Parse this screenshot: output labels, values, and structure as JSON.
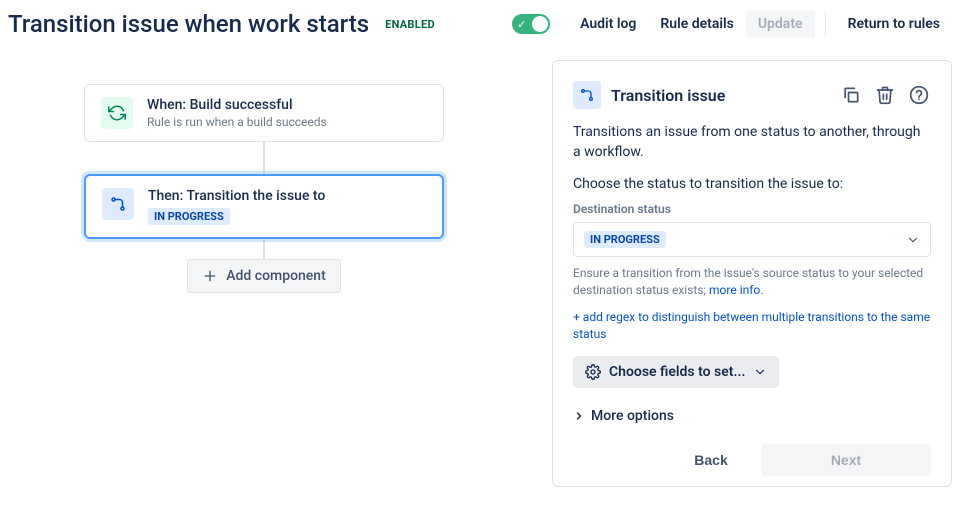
{
  "header": {
    "title": "Transition issue when work starts",
    "enabled_badge": "ENABLED",
    "nav": {
      "audit_log": "Audit log",
      "rule_details": "Rule details",
      "update": "Update",
      "return": "Return to rules"
    }
  },
  "flow": {
    "trigger": {
      "title": "When: Build successful",
      "subtitle": "Rule is run when a build succeeds"
    },
    "action": {
      "title": "Then: Transition the issue to",
      "status": "IN PROGRESS"
    },
    "add_component": "Add component"
  },
  "panel": {
    "title": "Transition issue",
    "description": "Transitions an issue from one status to another, through a workflow.",
    "choose_label": "Choose the status to transition the issue to:",
    "field_label": "Destination status",
    "selected_status": "IN PROGRESS",
    "helper_text": "Ensure a transition from the issue's source status to your selected destination status exists; ",
    "helper_link": "more info",
    "regex_link": "+ add regex to distinguish between multiple transitions to the same status",
    "choose_fields": "Choose fields to set...",
    "more_options": "More options",
    "back": "Back",
    "next": "Next"
  }
}
